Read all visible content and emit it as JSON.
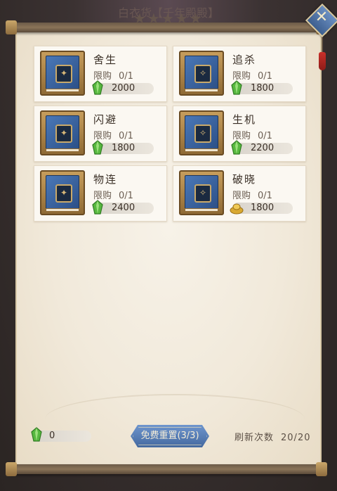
{
  "background": {
    "title": "白衣货【千年殿殿】",
    "stars": "★★★★★"
  },
  "close_button": {
    "glyph": "✕"
  },
  "shop": {
    "limit_label": "限购",
    "items": [
      {
        "name": "舍生",
        "limit": "0/1",
        "price": "2000",
        "currency": "green-crystal"
      },
      {
        "name": "追杀",
        "limit": "0/1",
        "price": "1800",
        "currency": "green-crystal"
      },
      {
        "name": "闪避",
        "limit": "0/1",
        "price": "1800",
        "currency": "green-crystal"
      },
      {
        "name": "生机",
        "limit": "0/1",
        "price": "2200",
        "currency": "green-crystal"
      },
      {
        "name": "物连",
        "limit": "0/1",
        "price": "2400",
        "currency": "green-crystal"
      },
      {
        "name": "破晓",
        "limit": "0/1",
        "price": "1800",
        "currency": "gold-ingot"
      }
    ]
  },
  "footer": {
    "balance": "0",
    "reset_label": "免费重置(3/3)",
    "refresh_label": "刷新次数",
    "refresh_value": "20/20"
  },
  "colors": {
    "green_crystal": "#4caf3a",
    "gold_ingot": "#d9a932",
    "button_blue": "#5a82bb"
  }
}
